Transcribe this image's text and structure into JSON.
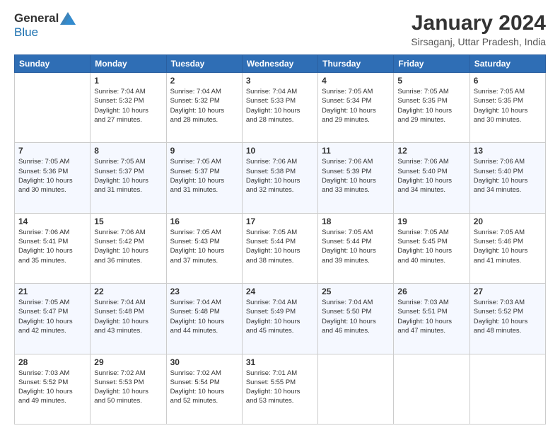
{
  "header": {
    "logo_general": "General",
    "logo_blue": "Blue",
    "title": "January 2024",
    "subtitle": "Sirsaganj, Uttar Pradesh, India"
  },
  "days_of_week": [
    "Sunday",
    "Monday",
    "Tuesday",
    "Wednesday",
    "Thursday",
    "Friday",
    "Saturday"
  ],
  "weeks": [
    [
      {
        "day": "",
        "detail": ""
      },
      {
        "day": "1",
        "detail": "Sunrise: 7:04 AM\nSunset: 5:32 PM\nDaylight: 10 hours\nand 27 minutes."
      },
      {
        "day": "2",
        "detail": "Sunrise: 7:04 AM\nSunset: 5:32 PM\nDaylight: 10 hours\nand 28 minutes."
      },
      {
        "day": "3",
        "detail": "Sunrise: 7:04 AM\nSunset: 5:33 PM\nDaylight: 10 hours\nand 28 minutes."
      },
      {
        "day": "4",
        "detail": "Sunrise: 7:05 AM\nSunset: 5:34 PM\nDaylight: 10 hours\nand 29 minutes."
      },
      {
        "day": "5",
        "detail": "Sunrise: 7:05 AM\nSunset: 5:35 PM\nDaylight: 10 hours\nand 29 minutes."
      },
      {
        "day": "6",
        "detail": "Sunrise: 7:05 AM\nSunset: 5:35 PM\nDaylight: 10 hours\nand 30 minutes."
      }
    ],
    [
      {
        "day": "7",
        "detail": "Sunrise: 7:05 AM\nSunset: 5:36 PM\nDaylight: 10 hours\nand 30 minutes."
      },
      {
        "day": "8",
        "detail": "Sunrise: 7:05 AM\nSunset: 5:37 PM\nDaylight: 10 hours\nand 31 minutes."
      },
      {
        "day": "9",
        "detail": "Sunrise: 7:05 AM\nSunset: 5:37 PM\nDaylight: 10 hours\nand 31 minutes."
      },
      {
        "day": "10",
        "detail": "Sunrise: 7:06 AM\nSunset: 5:38 PM\nDaylight: 10 hours\nand 32 minutes."
      },
      {
        "day": "11",
        "detail": "Sunrise: 7:06 AM\nSunset: 5:39 PM\nDaylight: 10 hours\nand 33 minutes."
      },
      {
        "day": "12",
        "detail": "Sunrise: 7:06 AM\nSunset: 5:40 PM\nDaylight: 10 hours\nand 34 minutes."
      },
      {
        "day": "13",
        "detail": "Sunrise: 7:06 AM\nSunset: 5:40 PM\nDaylight: 10 hours\nand 34 minutes."
      }
    ],
    [
      {
        "day": "14",
        "detail": "Sunrise: 7:06 AM\nSunset: 5:41 PM\nDaylight: 10 hours\nand 35 minutes."
      },
      {
        "day": "15",
        "detail": "Sunrise: 7:06 AM\nSunset: 5:42 PM\nDaylight: 10 hours\nand 36 minutes."
      },
      {
        "day": "16",
        "detail": "Sunrise: 7:05 AM\nSunset: 5:43 PM\nDaylight: 10 hours\nand 37 minutes."
      },
      {
        "day": "17",
        "detail": "Sunrise: 7:05 AM\nSunset: 5:44 PM\nDaylight: 10 hours\nand 38 minutes."
      },
      {
        "day": "18",
        "detail": "Sunrise: 7:05 AM\nSunset: 5:44 PM\nDaylight: 10 hours\nand 39 minutes."
      },
      {
        "day": "19",
        "detail": "Sunrise: 7:05 AM\nSunset: 5:45 PM\nDaylight: 10 hours\nand 40 minutes."
      },
      {
        "day": "20",
        "detail": "Sunrise: 7:05 AM\nSunset: 5:46 PM\nDaylight: 10 hours\nand 41 minutes."
      }
    ],
    [
      {
        "day": "21",
        "detail": "Sunrise: 7:05 AM\nSunset: 5:47 PM\nDaylight: 10 hours\nand 42 minutes."
      },
      {
        "day": "22",
        "detail": "Sunrise: 7:04 AM\nSunset: 5:48 PM\nDaylight: 10 hours\nand 43 minutes."
      },
      {
        "day": "23",
        "detail": "Sunrise: 7:04 AM\nSunset: 5:48 PM\nDaylight: 10 hours\nand 44 minutes."
      },
      {
        "day": "24",
        "detail": "Sunrise: 7:04 AM\nSunset: 5:49 PM\nDaylight: 10 hours\nand 45 minutes."
      },
      {
        "day": "25",
        "detail": "Sunrise: 7:04 AM\nSunset: 5:50 PM\nDaylight: 10 hours\nand 46 minutes."
      },
      {
        "day": "26",
        "detail": "Sunrise: 7:03 AM\nSunset: 5:51 PM\nDaylight: 10 hours\nand 47 minutes."
      },
      {
        "day": "27",
        "detail": "Sunrise: 7:03 AM\nSunset: 5:52 PM\nDaylight: 10 hours\nand 48 minutes."
      }
    ],
    [
      {
        "day": "28",
        "detail": "Sunrise: 7:03 AM\nSunset: 5:52 PM\nDaylight: 10 hours\nand 49 minutes."
      },
      {
        "day": "29",
        "detail": "Sunrise: 7:02 AM\nSunset: 5:53 PM\nDaylight: 10 hours\nand 50 minutes."
      },
      {
        "day": "30",
        "detail": "Sunrise: 7:02 AM\nSunset: 5:54 PM\nDaylight: 10 hours\nand 52 minutes."
      },
      {
        "day": "31",
        "detail": "Sunrise: 7:01 AM\nSunset: 5:55 PM\nDaylight: 10 hours\nand 53 minutes."
      },
      {
        "day": "",
        "detail": ""
      },
      {
        "day": "",
        "detail": ""
      },
      {
        "day": "",
        "detail": ""
      }
    ]
  ]
}
